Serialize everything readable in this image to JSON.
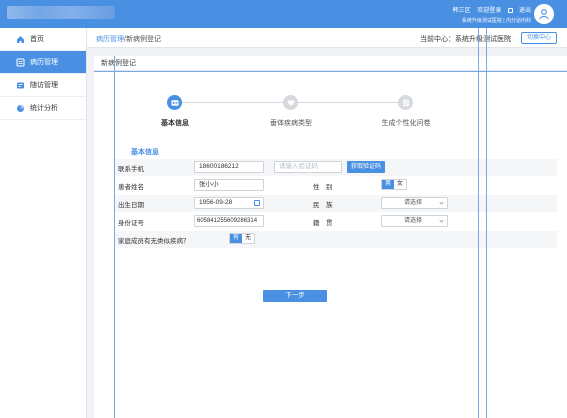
{
  "header": {
    "user_name": "韩三区",
    "welcome": "欢迎登录",
    "logout": "退出",
    "subtitle": "系统升级测试医院 | 内分泌内科"
  },
  "sidebar": {
    "items": [
      {
        "label": "首页",
        "icon": "home-icon",
        "active": false
      },
      {
        "label": "病历管理",
        "icon": "record-icon",
        "active": true
      },
      {
        "label": "随访管理",
        "icon": "followup-icon",
        "active": false
      },
      {
        "label": "统计分析",
        "icon": "pie-chart-icon",
        "active": false
      }
    ]
  },
  "breadcrumb": {
    "parent": "病历管理",
    "separator": "/",
    "current": "新病例登记"
  },
  "center": {
    "label": "当前中心：系统升级测试医院",
    "switch_label": "切换中心"
  },
  "panel": {
    "title": "新病例登记"
  },
  "steps": [
    {
      "label": "基本信息",
      "state": "active",
      "icon": "id-card-icon"
    },
    {
      "label": "垂体疾病类型",
      "state": "pending",
      "icon": "heart-icon"
    },
    {
      "label": "生成个性化问卷",
      "state": "pending",
      "icon": "form-icon"
    }
  ],
  "form": {
    "section_title": "基本信息",
    "phone_label": "联系手机",
    "phone_value": "18600186212",
    "captcha_placeholder": "请输入验证码",
    "get_code_label": "获取验证码",
    "name_label": "患者姓名",
    "name_value": "张小小",
    "gender_label": "性　别",
    "gender_options": [
      "男",
      "女"
    ],
    "gender_selected": "男",
    "birth_label": "出生日期",
    "birth_value": "1956-09-28",
    "ethnicity_label": "民　族",
    "ethnicity_value": "请选择",
    "id_label": "身份证号",
    "id_value": "605841255609286314",
    "native_label": "籍　贯",
    "native_value": "请选择",
    "family_label": "家庭成员有无类似疾病？",
    "family_options": [
      "有",
      "无"
    ],
    "family_selected": "有"
  },
  "next_label": "下一步",
  "colors": {
    "primary": "#4a90e2",
    "sidebar_active": "#4a90e2",
    "step_active": "#4a90e2",
    "step_pending": "#d6d9de"
  }
}
